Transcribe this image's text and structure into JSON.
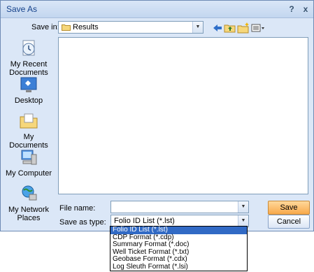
{
  "dialog": {
    "title": "Save As",
    "help_label": "?",
    "close_label": "x"
  },
  "save_in": {
    "label": "Save in:",
    "value": "Results"
  },
  "places": [
    {
      "label": "My Recent Documents",
      "icon": "recent-documents-icon"
    },
    {
      "label": "Desktop",
      "icon": "desktop-icon"
    },
    {
      "label": "My Documents",
      "icon": "my-documents-icon"
    },
    {
      "label": "My Computer",
      "icon": "my-computer-icon"
    },
    {
      "label": "My Network Places",
      "icon": "network-places-icon"
    }
  ],
  "file_name": {
    "label": "File name:",
    "value": ""
  },
  "save_as_type": {
    "label": "Save as type:",
    "value": "Folio ID List (*.lst)",
    "options": [
      "Folio ID List (*.lst)",
      "CDP Format (*.cdp)",
      "Summary Format (*.doc)",
      "Well Ticket Format (*.txt)",
      "Geobase Format (*.cdx)",
      "Log Sleuth Format (*.lsi)"
    ],
    "selected_index": 0
  },
  "buttons": {
    "save": "Save",
    "cancel": "Cancel"
  },
  "colors": {
    "selection": "#316ac5",
    "default_button": "#f8a94b"
  }
}
